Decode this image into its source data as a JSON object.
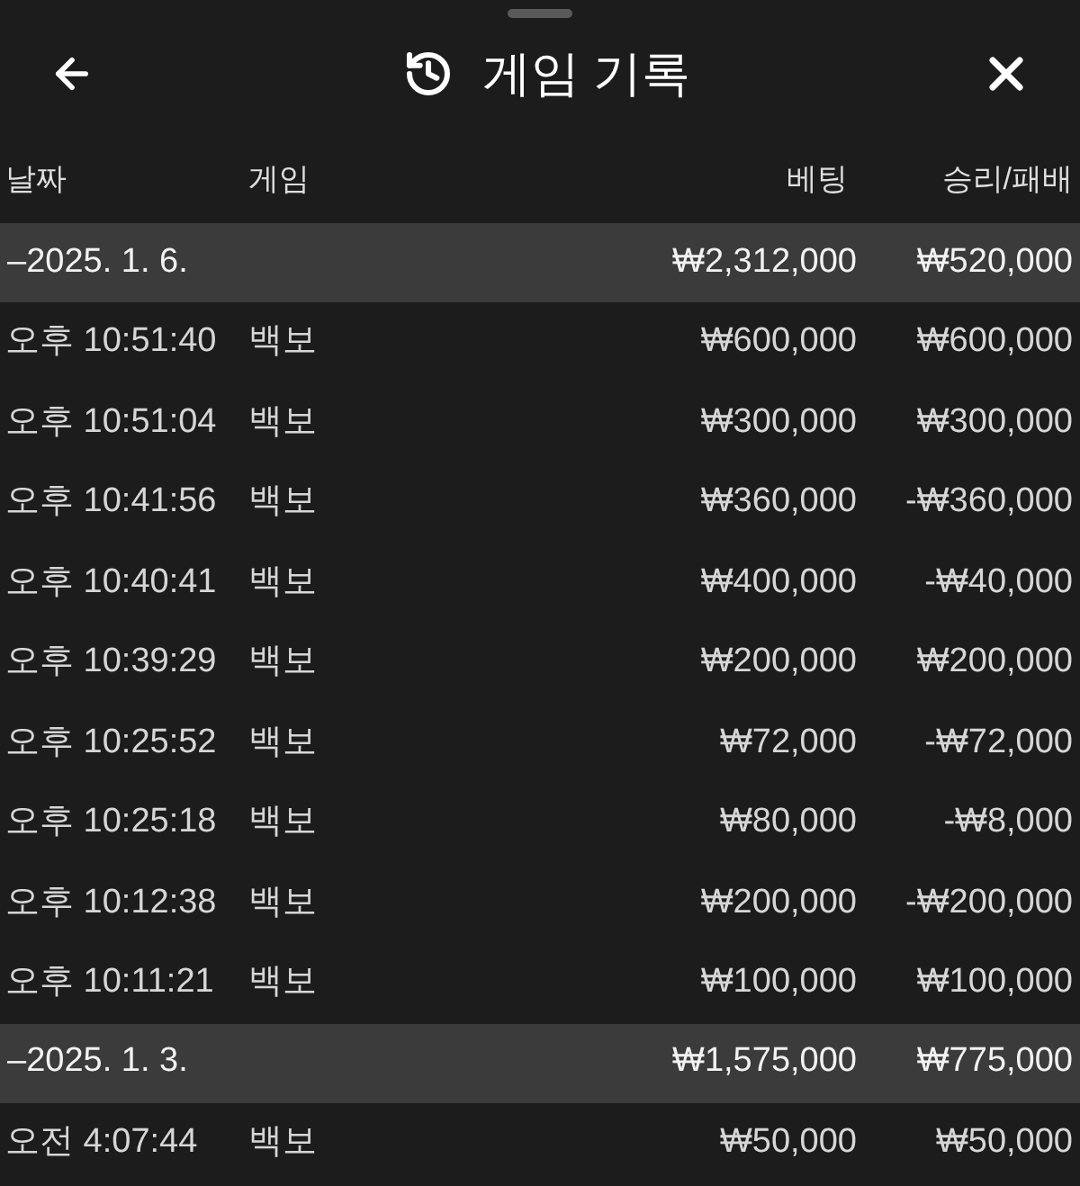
{
  "sheet": {
    "title": "게임 기록"
  },
  "table": {
    "columns": [
      "날짜",
      "게임",
      "베팅",
      "승리/패배"
    ],
    "groups": [
      {
        "date": "–2025. 1. 6.",
        "bet_total": "₩2,312,000",
        "result_total": "₩520,000",
        "rows": [
          {
            "time": "오후 10:51:40",
            "game": "백보",
            "bet": "₩600,000",
            "result": "₩600,000"
          },
          {
            "time": "오후 10:51:04",
            "game": "백보",
            "bet": "₩300,000",
            "result": "₩300,000"
          },
          {
            "time": "오후 10:41:56",
            "game": "백보",
            "bet": "₩360,000",
            "result": "-₩360,000"
          },
          {
            "time": "오후 10:40:41",
            "game": "백보",
            "bet": "₩400,000",
            "result": "-₩40,000"
          },
          {
            "time": "오후 10:39:29",
            "game": "백보",
            "bet": "₩200,000",
            "result": "₩200,000"
          },
          {
            "time": "오후 10:25:52",
            "game": "백보",
            "bet": "₩72,000",
            "result": "-₩72,000"
          },
          {
            "time": "오후 10:25:18",
            "game": "백보",
            "bet": "₩80,000",
            "result": "-₩8,000"
          },
          {
            "time": "오후 10:12:38",
            "game": "백보",
            "bet": "₩200,000",
            "result": "-₩200,000"
          },
          {
            "time": "오후 10:11:21",
            "game": "백보",
            "bet": "₩100,000",
            "result": "₩100,000"
          }
        ]
      },
      {
        "date": "–2025. 1. 3.",
        "bet_total": "₩1,575,000",
        "result_total": "₩775,000",
        "rows": [
          {
            "time": "오전 4:07:44",
            "game": "백보",
            "bet": "₩50,000",
            "result": "₩50,000"
          }
        ]
      }
    ]
  }
}
